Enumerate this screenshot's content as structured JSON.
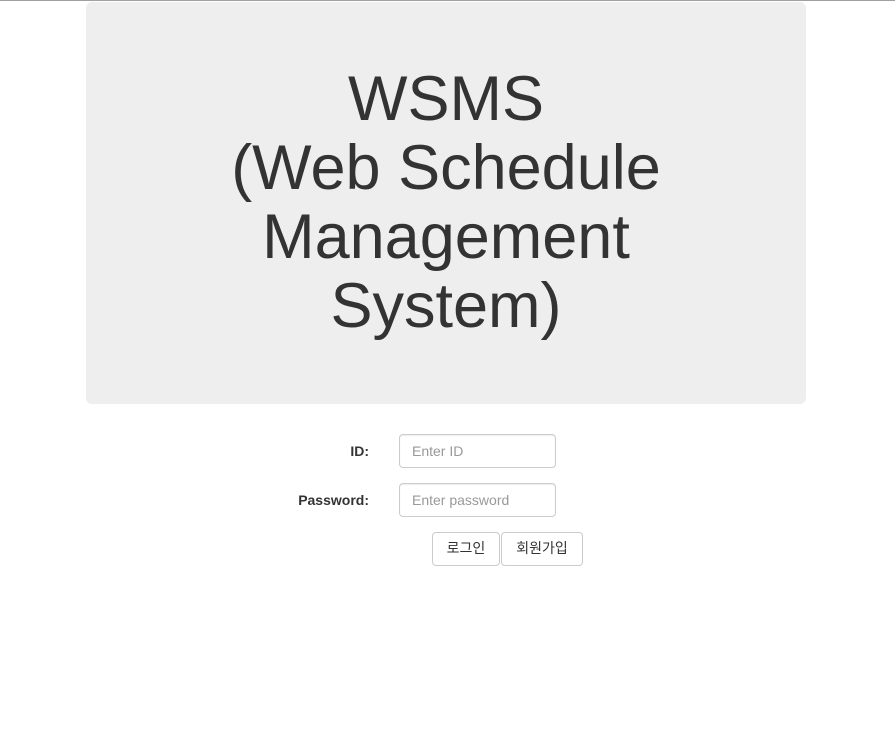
{
  "jumbotron": {
    "title_lines": [
      "WSMS",
      "(Web Schedule",
      "Management",
      "System)"
    ]
  },
  "form": {
    "id_label": "ID:",
    "id_placeholder": "Enter ID",
    "id_value": "",
    "password_label": "Password:",
    "password_placeholder": "Enter password",
    "password_value": ""
  },
  "buttons": {
    "login_label": "로그인",
    "signup_label": "회원가입"
  }
}
